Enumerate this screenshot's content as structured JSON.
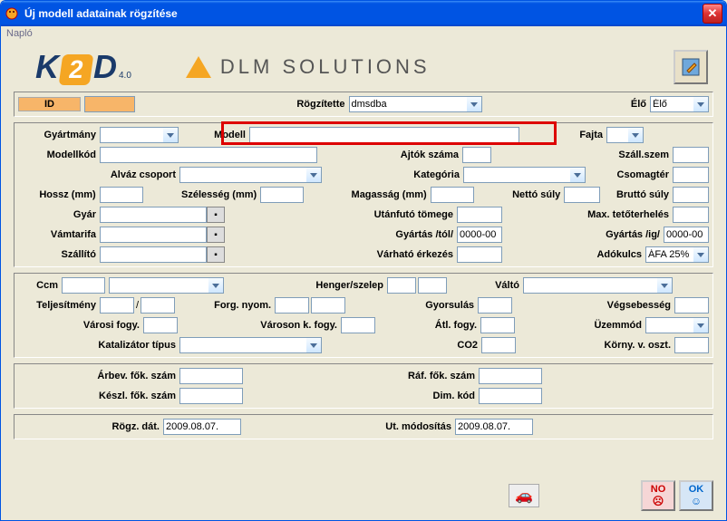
{
  "window": {
    "title": "Új modell adatainak rögzítése"
  },
  "menu": {
    "item1": "Napló"
  },
  "logos": {
    "k2d_ver": "4.0",
    "dlm": "DLM SOLUTIONS"
  },
  "top": {
    "id_label": "ID",
    "id_value": "",
    "rogzitette_label": "Rögzítette",
    "rogzitette_value": "dmsdba",
    "elo_label": "Élő",
    "elo_value": "Élő"
  },
  "sec1": {
    "gyartmany_label": "Gyártmány",
    "gyartmany": "",
    "modell_label": "Modell",
    "modell": "",
    "fajta_label": "Fajta",
    "fajta": "",
    "modellkod_label": "Modellkód",
    "modellkod": "",
    "ajtok_label": "Ajtók száma",
    "ajtok": "",
    "szallszem_label": "Száll.szem",
    "szallszem": "",
    "alvaz_label": "Alváz csoport",
    "alvaz": "",
    "kategoria_label": "Kategória",
    "kategoria": "",
    "csomagter_label": "Csomagtér",
    "csomagter": "",
    "hossz_label": "Hossz (mm)",
    "hossz": "",
    "szelesseg_label": "Szélesség (mm)",
    "szelesseg": "",
    "magassag_label": "Magasság (mm)",
    "magassag": "",
    "nettosuly_label": "Nettó súly",
    "nettosuly": "",
    "bruttosuly_label": "Bruttó súly",
    "bruttosuly": "",
    "gyar_label": "Gyár",
    "gyar": "",
    "utanfuto_label": "Utánfutó tömege",
    "utanfuto": "",
    "maxteto_label": "Max. tetőterhelés",
    "maxteto": "",
    "vamtarifa_label": "Vámtarifa",
    "vamtarifa": "",
    "gyartastol_label": "Gyártás /tól/",
    "gyartastol": "0000-00",
    "gyartasig_label": "Gyártás /ig/",
    "gyartasig": "0000-00",
    "szallito_label": "Szállító",
    "szallito": "",
    "varhato_label": "Várható érkezés",
    "varhato": "",
    "adokulcs_label": "Adókulcs",
    "adokulcs": "ÁFA 25%"
  },
  "sec2": {
    "ccm_label": "Ccm",
    "ccm": "",
    "ccm_sel": "",
    "henger_label": "Henger/szelep",
    "henger1": "",
    "henger2": "",
    "valto_label": "Váltó",
    "valto": "",
    "teljesitmeny_label": "Teljesítmény",
    "telj1": "",
    "telj2": "",
    "forgnyom_label": "Forg. nyom.",
    "forgnyom1": "",
    "forgnyom2": "",
    "gyorsulas_label": "Gyorsulás",
    "gyorsulas": "",
    "vegsebesseg_label": "Végsebesség",
    "vegsebesseg": "",
    "varosi_label": "Városi fogy.",
    "varosi": "",
    "varoskf_label": "Városon k. fogy.",
    "varoskf": "",
    "atl_label": "Átl. fogy.",
    "atl": "",
    "uzemmod_label": "Üzemmód",
    "uzemmod": "",
    "katalizator_label": "Katalizátor típus",
    "katalizator": "",
    "co2_label": "CO2",
    "co2": "",
    "korny_label": "Körny. v. oszt.",
    "korny": ""
  },
  "sec3": {
    "arbev_label": "Árbev. fők. szám",
    "arbev": "",
    "raf_label": "Ráf. fők. szám",
    "raf": "",
    "keszl_label": "Készl. fők. szám",
    "keszl": "",
    "dim_label": "Dim. kód",
    "dim": ""
  },
  "sec4": {
    "rogzdat_label": "Rögz. dát.",
    "rogzdat": "2009.08.07.",
    "utmod_label": "Ut. módosítás",
    "utmod": "2009.08.07."
  },
  "buttons": {
    "no": "NO",
    "ok": "OK"
  }
}
